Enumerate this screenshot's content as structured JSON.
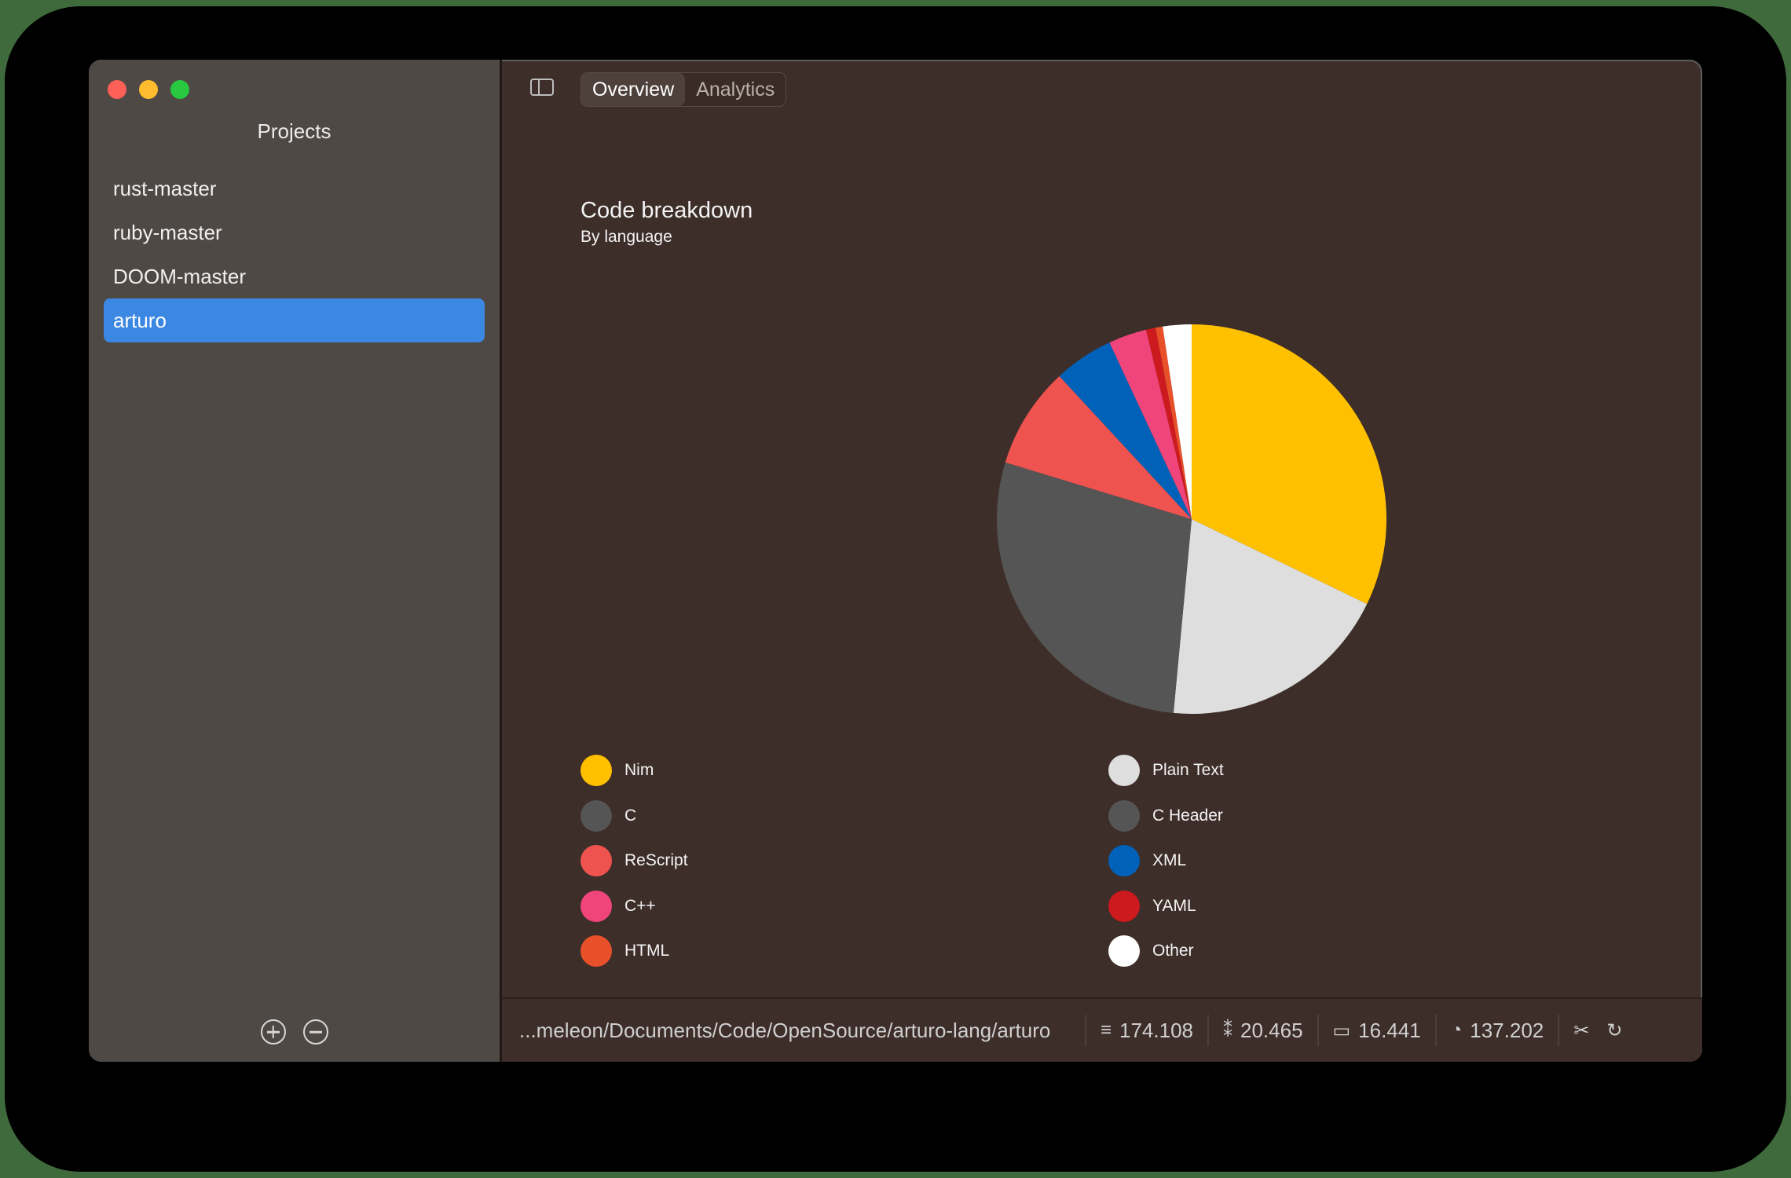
{
  "sidebar": {
    "title": "Projects",
    "projects": [
      {
        "label": "rust-master"
      },
      {
        "label": "ruby-master"
      },
      {
        "label": "DOOM-master"
      },
      {
        "label": "arturo",
        "selected": true
      }
    ],
    "add_icon": "plus-circle-icon",
    "remove_icon": "minus-circle-icon"
  },
  "tabs": [
    {
      "label": "Overview",
      "active": true
    },
    {
      "label": "Analytics",
      "active": false
    }
  ],
  "chart_data": {
    "type": "pie",
    "title": "Code breakdown",
    "subtitle": "By language",
    "slices": [
      {
        "name": "Nim",
        "value": 32.5,
        "color": "#ffc000"
      },
      {
        "name": "Plain Text",
        "value": 19.5,
        "color": "#dedede"
      },
      {
        "name": "C",
        "value": 28.5,
        "color": "#555555"
      },
      {
        "name": "ReScript",
        "value": 8.5,
        "color": "#ef5350"
      },
      {
        "name": "XML",
        "value": 5.0,
        "color": "#0061b8"
      },
      {
        "name": "C++",
        "value": 3.2,
        "color": "#f0457a"
      },
      {
        "name": "YAML",
        "value": 0.8,
        "color": "#cc1a1f"
      },
      {
        "name": "HTML",
        "value": 0.6,
        "color": "#e8502a"
      },
      {
        "name": "Other",
        "value": 2.4,
        "color": "#ffffff"
      }
    ],
    "legend_left": [
      {
        "name": "Nim",
        "color": "#ffc000"
      },
      {
        "name": "C",
        "color": "#555555"
      },
      {
        "name": "ReScript",
        "color": "#ef5350"
      },
      {
        "name": "C++",
        "color": "#f0457a"
      },
      {
        "name": "HTML",
        "color": "#e8502a"
      }
    ],
    "legend_right": [
      {
        "name": "Plain Text",
        "color": "#dedede"
      },
      {
        "name": "C Header",
        "color": "#555555"
      },
      {
        "name": "XML",
        "color": "#0061b8"
      },
      {
        "name": "YAML",
        "color": "#cc1a1f"
      },
      {
        "name": "Other",
        "color": "#ffffff"
      }
    ]
  },
  "status": {
    "path": "...meleon/Documents/Code/OpenSource/arturo-lang/arturo",
    "lines": "174.108",
    "blanks": "20.465",
    "comments": "16.441",
    "code": "137.202"
  }
}
